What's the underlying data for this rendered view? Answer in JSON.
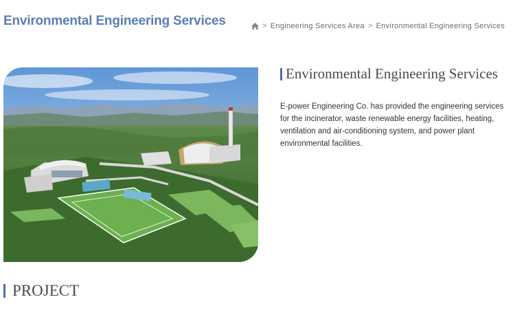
{
  "header": {
    "title": "Environmental Engineering Services",
    "breadcrumb": {
      "home_icon": "home-icon",
      "items": [
        "Engineering Services Area",
        "Environmental Engineering Services"
      ]
    }
  },
  "intro": {
    "heading": "Environmental Engineering Services",
    "description": "E-power Engineering Co. has provided the engineering services for the incinerator, waste renewable energy facilities, heating, ventilation and air-conditioning system, and power plant environmental facilities."
  },
  "project": {
    "heading": "PROJECT"
  },
  "colors": {
    "title_blue": "#5b7db5",
    "accent_bar": "#4b6fa8",
    "text": "#333333"
  }
}
